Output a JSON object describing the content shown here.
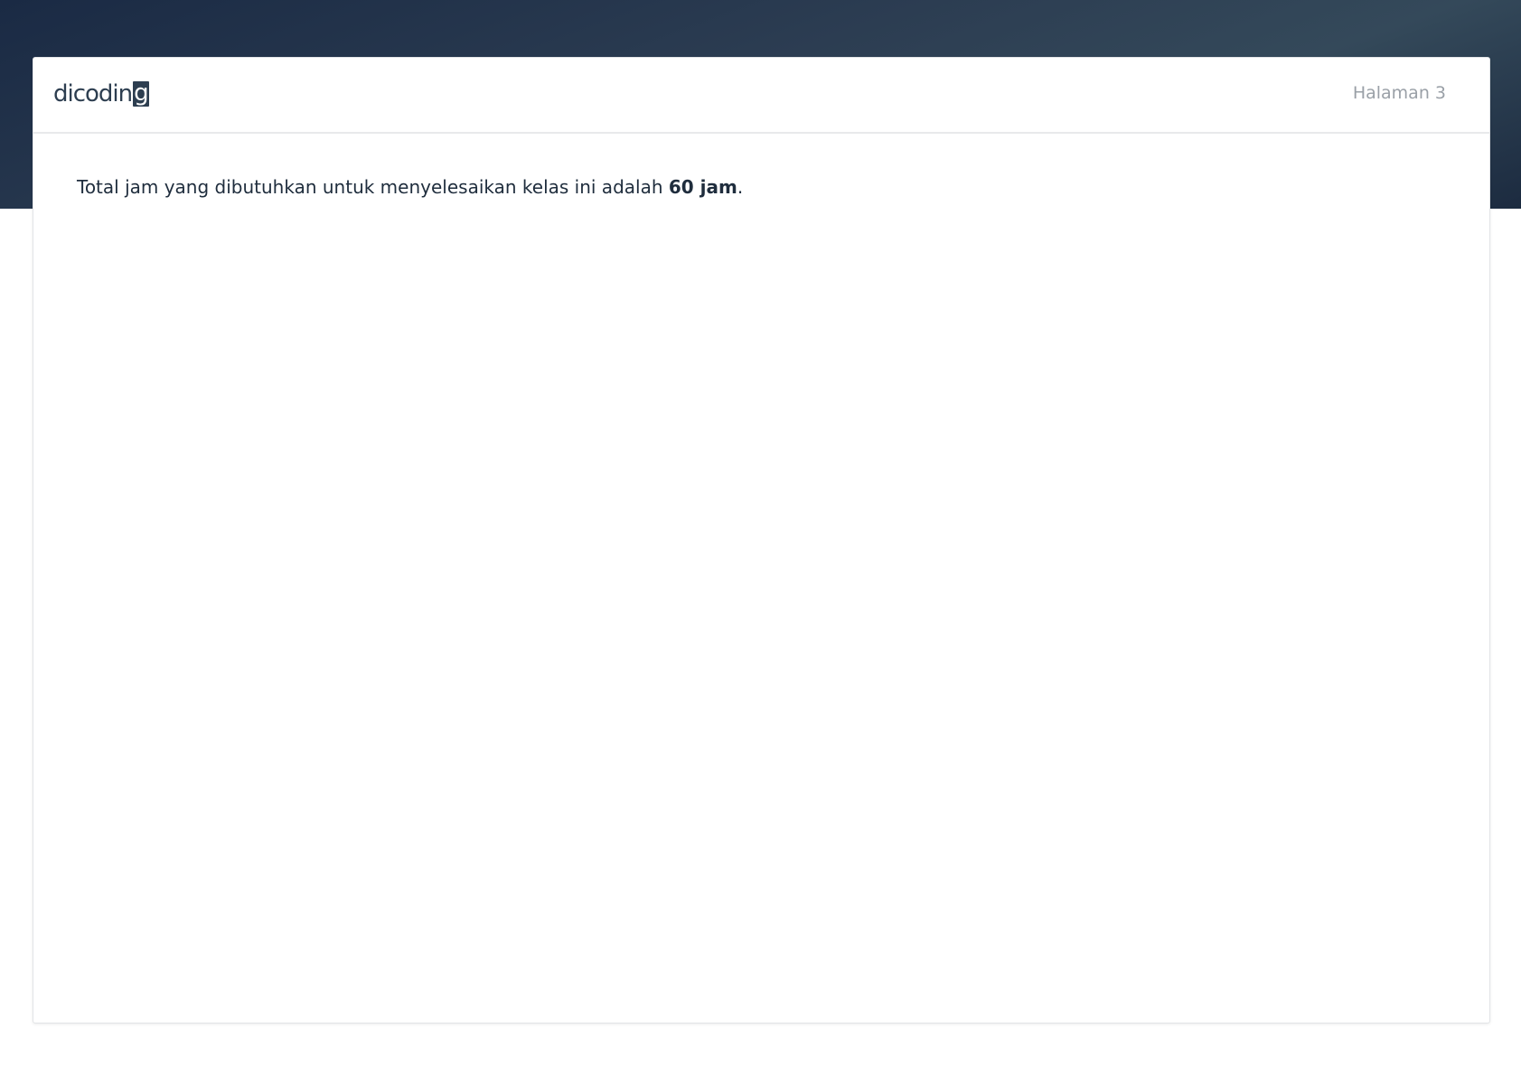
{
  "logo": {
    "text_main": "dicodin",
    "text_last": "g"
  },
  "header": {
    "page_label": "Halaman 3"
  },
  "content": {
    "sentence_before": "Total jam yang dibutuhkan untuk menyelesaikan kelas ini adalah ",
    "hours_bold": "60 jam",
    "sentence_after": "."
  },
  "colors": {
    "header_band": "#1f2f45",
    "text": "#1f2d3d",
    "page_label": "#9aa0a7"
  }
}
